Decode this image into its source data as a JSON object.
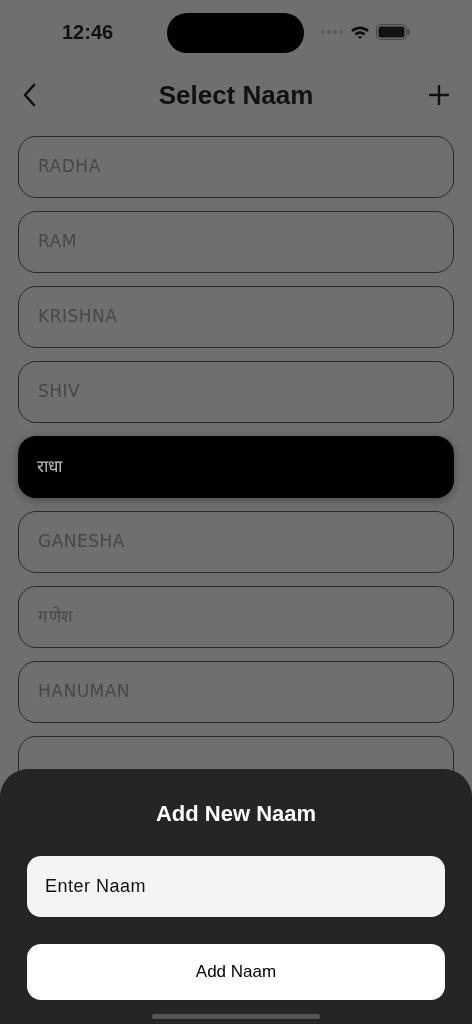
{
  "status_bar": {
    "time": "12:46"
  },
  "header": {
    "title": "Select Naam"
  },
  "items": [
    {
      "label": "RADHA",
      "selected": false
    },
    {
      "label": "RAM",
      "selected": false
    },
    {
      "label": "KRISHNA",
      "selected": false
    },
    {
      "label": "SHIV",
      "selected": false
    },
    {
      "label": "राधा",
      "selected": true
    },
    {
      "label": "GANESHA",
      "selected": false
    },
    {
      "label": "गणेश",
      "selected": false
    },
    {
      "label": "HANUMAN",
      "selected": false
    },
    {
      "selected": false
    }
  ],
  "sheet": {
    "title": "Add New Naam",
    "placeholder": "Enter Naam",
    "button": "Add Naam"
  }
}
